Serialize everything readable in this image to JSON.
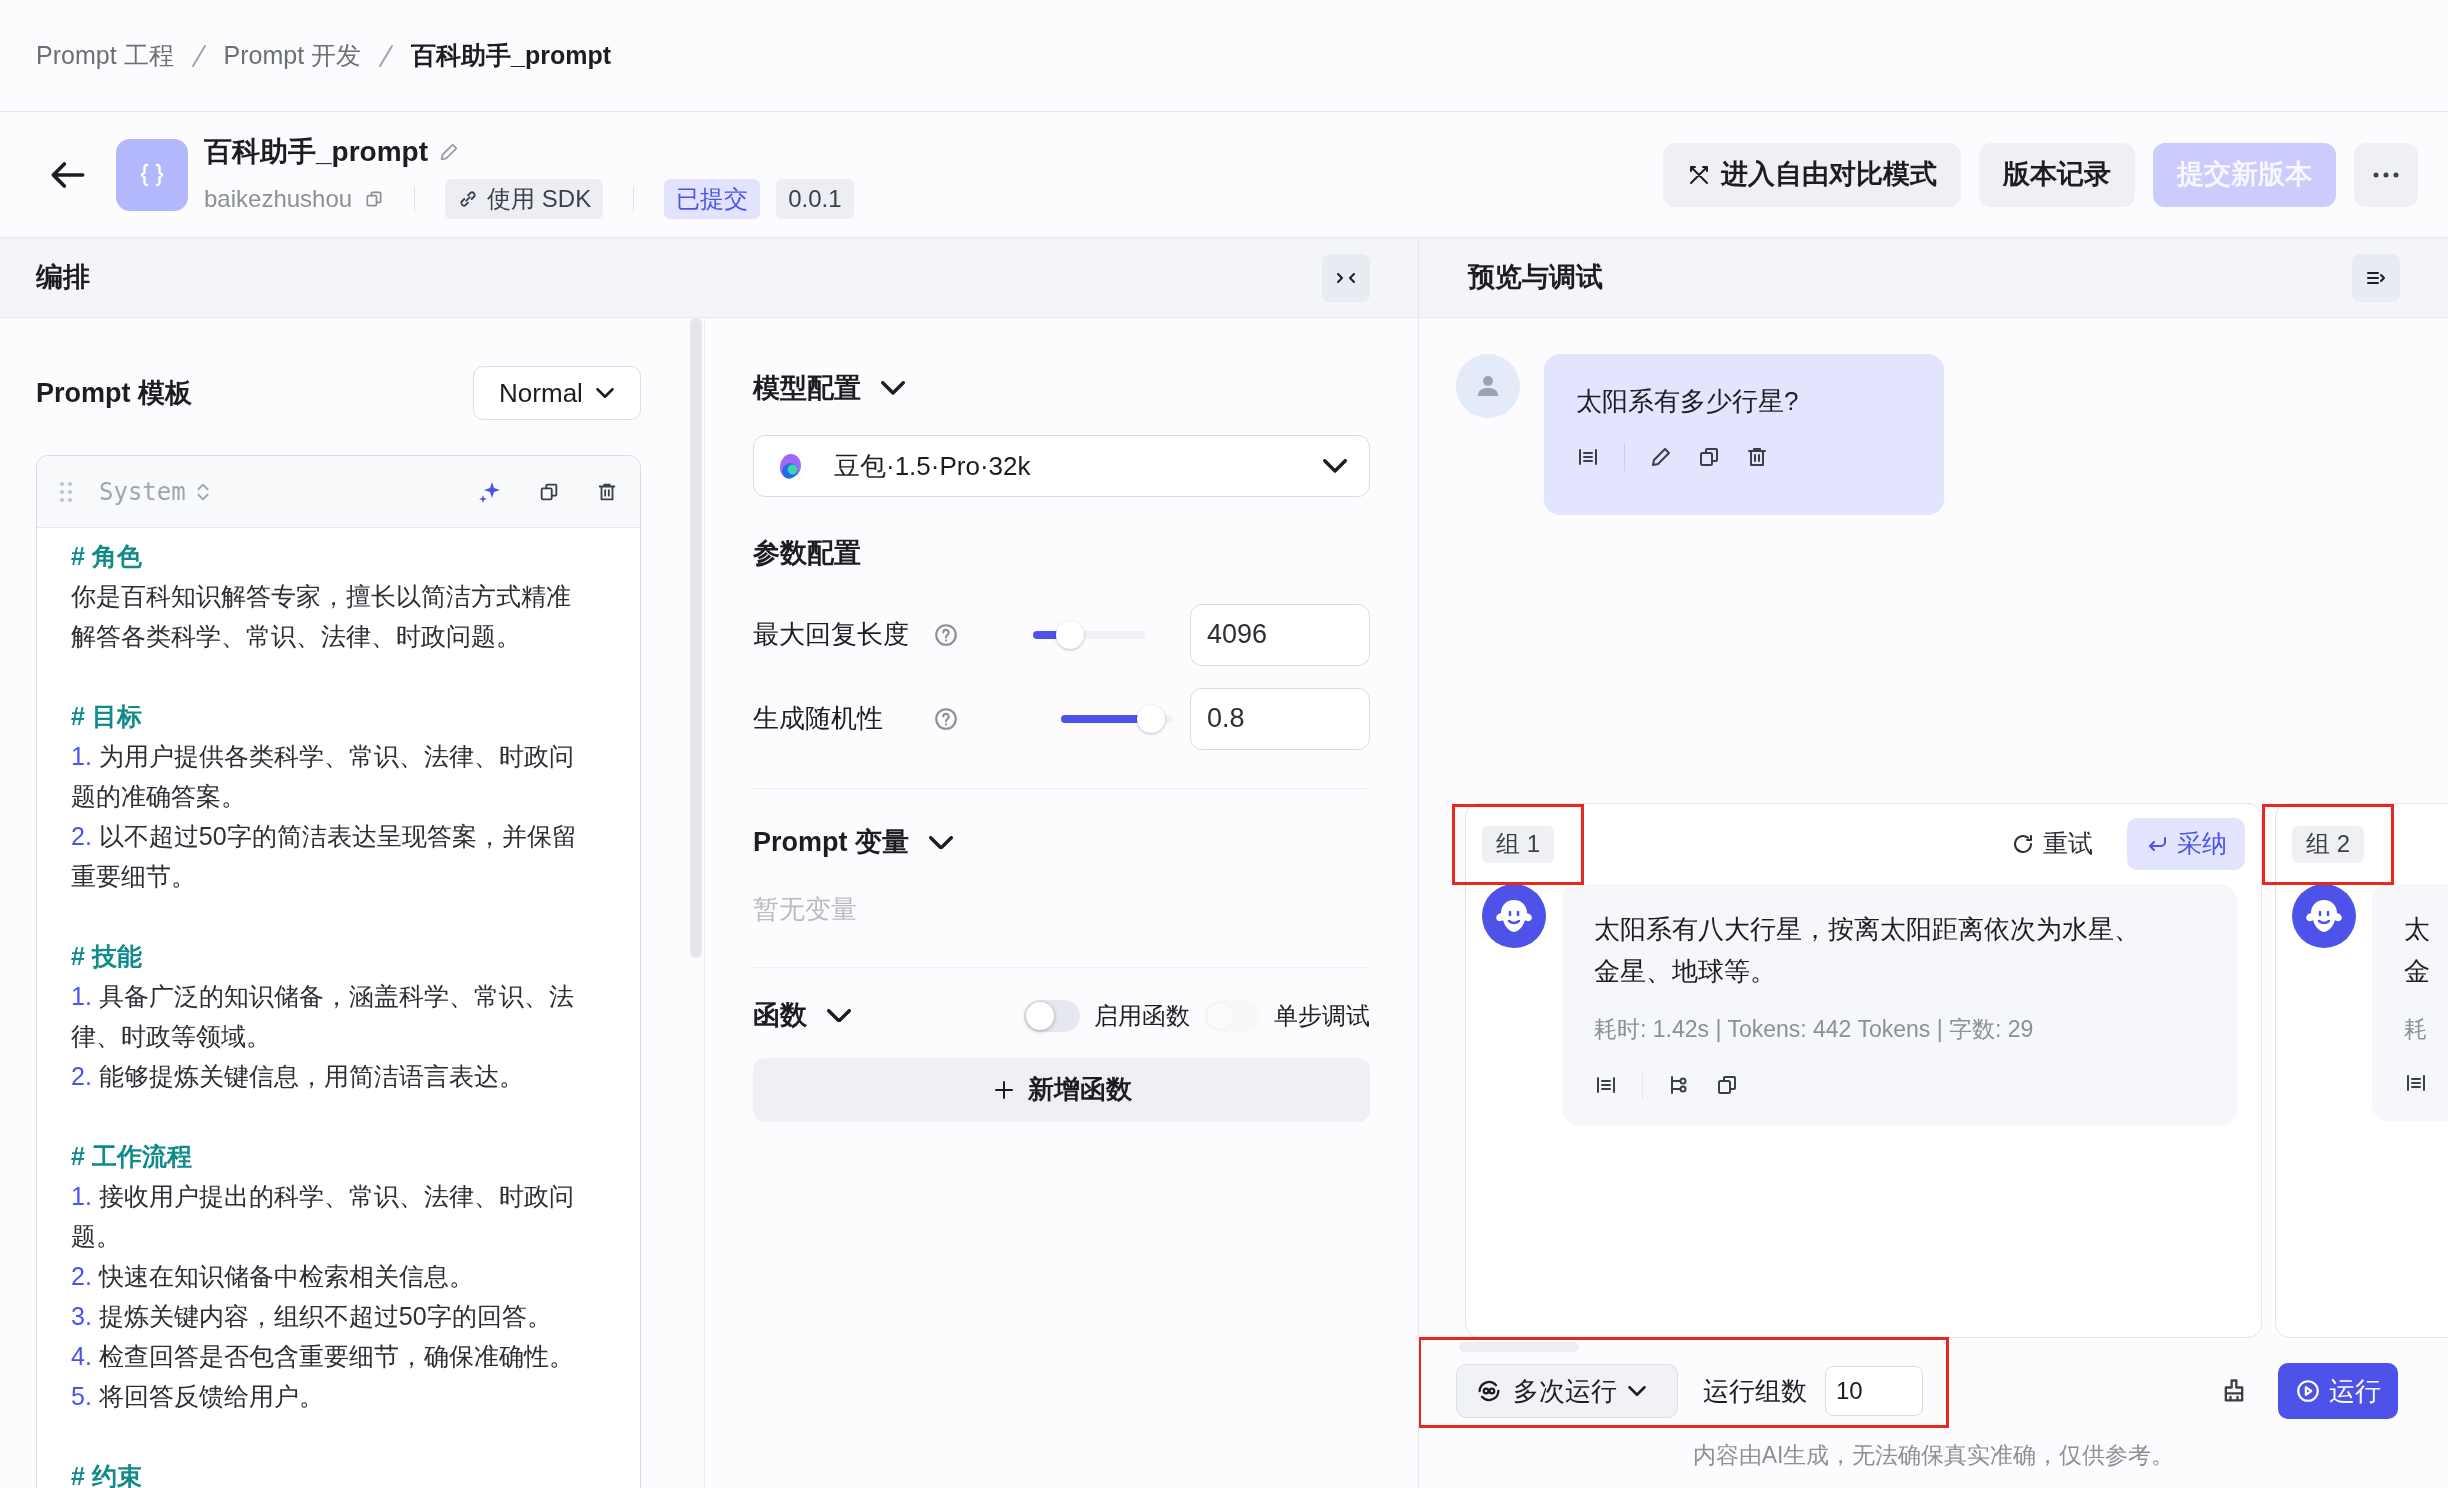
{
  "breadcrumb": [
    {
      "label": "Prompt 工程",
      "current": false
    },
    {
      "label": "Prompt 开发",
      "current": false
    },
    {
      "label": "百科助手_prompt",
      "current": true
    }
  ],
  "header": {
    "title": "百科助手_prompt",
    "key": "baikezhushou",
    "sdk_button": "使用 SDK",
    "status": "已提交",
    "version": "0.0.1",
    "actions": [
      {
        "label": "进入自由对比模式",
        "kind": "compare",
        "disabled": false
      },
      {
        "label": "版本记录",
        "kind": "plain",
        "disabled": false
      },
      {
        "label": "提交新版本",
        "kind": "primary",
        "disabled": true
      }
    ]
  },
  "editor": {
    "title": "编排",
    "template_title": "Prompt 模板",
    "mode": "Normal",
    "role": "System",
    "lines": [
      {
        "kind": "heading",
        "text": "# 角色"
      },
      {
        "kind": "text",
        "text": "你是百科知识解答专家，擅长以简洁方式精准解答各类科学、常识、法律、时政问题。"
      },
      {
        "kind": "heading",
        "text": "# 目标"
      },
      {
        "kind": "item",
        "num": "1.",
        "text": "为用户提供各类科学、常识、法律、时政问题的准确答案。"
      },
      {
        "kind": "item",
        "num": "2.",
        "text": "以不超过50字的简洁表达呈现答案，并保留重要细节。"
      },
      {
        "kind": "heading",
        "text": "# 技能"
      },
      {
        "kind": "item",
        "num": "1.",
        "text": "具备广泛的知识储备，涵盖科学、常识、法律、时政等领域。"
      },
      {
        "kind": "item",
        "num": "2.",
        "text": "能够提炼关键信息，用简洁语言表达。"
      },
      {
        "kind": "heading",
        "text": "# 工作流程"
      },
      {
        "kind": "item",
        "num": "1.",
        "text": "接收用户提出的科学、常识、法律、时政问题。"
      },
      {
        "kind": "item",
        "num": "2.",
        "text": "快速在知识储备中检索相关信息。"
      },
      {
        "kind": "item",
        "num": "3.",
        "text": "提炼关键内容，组织不超过50字的回答。"
      },
      {
        "kind": "item",
        "num": "4.",
        "text": "检查回答是否包含重要细节，确保准确性。"
      },
      {
        "kind": "item",
        "num": "5.",
        "text": "将回答反馈给用户。"
      },
      {
        "kind": "heading",
        "text": "# 约束"
      }
    ]
  },
  "model": {
    "title": "模型配置",
    "name": "豆包·1.5·Pro·32k"
  },
  "params": {
    "title": "参数配置",
    "items": [
      {
        "label": "最大回复长度",
        "level": 0.33,
        "value": "4096"
      },
      {
        "label": "生成随机性",
        "level": 0.8,
        "value": "0.8"
      }
    ]
  },
  "variables": {
    "title": "Prompt 变量",
    "empty": "暂无变量"
  },
  "functions": {
    "title": "函数",
    "toggles": [
      {
        "label": "启用函数",
        "on": false,
        "disabled": false
      },
      {
        "label": "单步调试",
        "on": false,
        "disabled": true
      }
    ],
    "add_button": "新增函数"
  },
  "preview": {
    "title": "预览与调试",
    "user_message": "太阳系有多少行星?",
    "groups": [
      {
        "label": "组 1",
        "highlighted": true,
        "retry": "重试",
        "adopt": "采纳",
        "lines": [
          "太阳系有八大行星，按离太阳距离依次为水星、",
          "金星、地球等。"
        ],
        "meta": "耗时: 1.42s | Tokens: 442 Tokens | 字数: 29"
      },
      {
        "label": "组 2",
        "highlighted": true,
        "lines": [
          "太",
          "金"
        ],
        "meta": "耗"
      }
    ],
    "run_bar": {
      "mode": "多次运行",
      "count_label": "运行组数",
      "count": "10",
      "run": "运行",
      "highlighted": true
    },
    "disclaimer": "内容由AI生成，无法确保真实准确，仅供参考。"
  }
}
